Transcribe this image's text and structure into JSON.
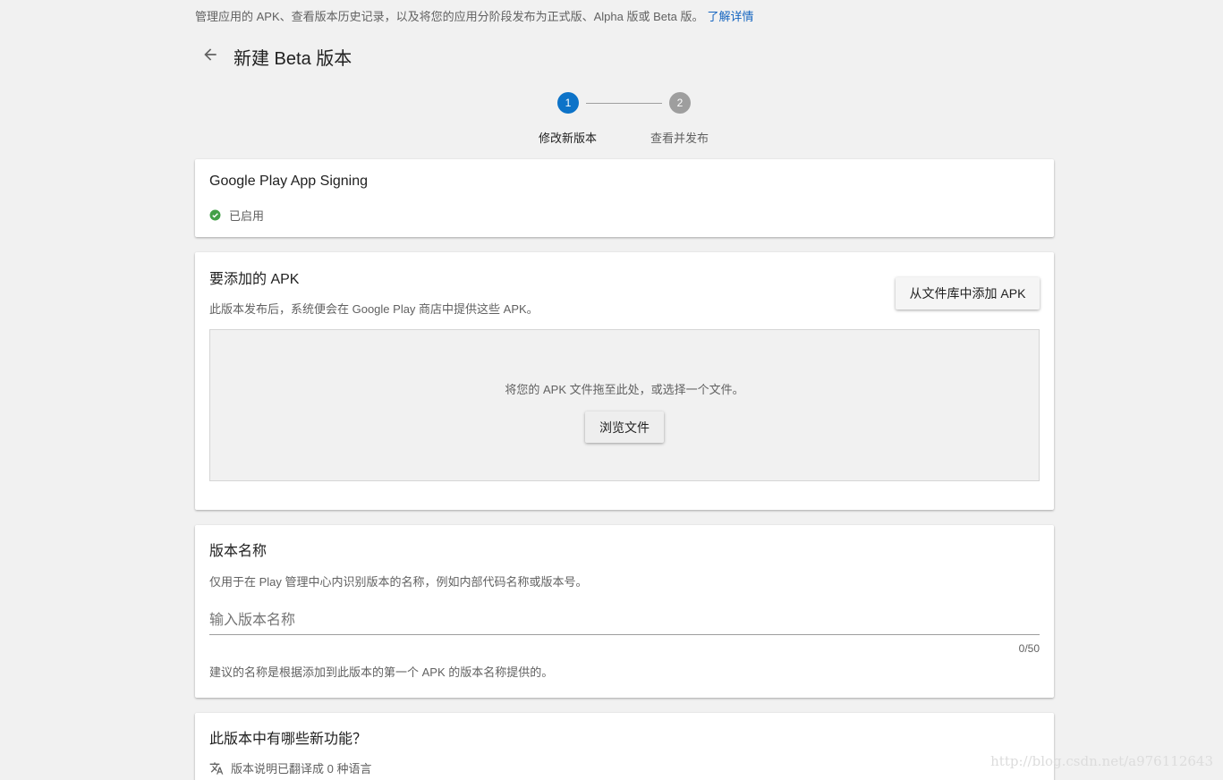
{
  "intro": {
    "text": "管理应用的 APK、查看版本历史记录，以及将您的应用分阶段发布为正式版、Alpha 版或 Beta 版。",
    "link": "了解详情"
  },
  "header": {
    "title": "新建 Beta 版本"
  },
  "stepper": {
    "steps": [
      {
        "number": "1",
        "label": "修改新版本",
        "active": true
      },
      {
        "number": "2",
        "label": "查看并发布",
        "active": false
      }
    ]
  },
  "signing": {
    "title": "Google Play App Signing",
    "status": "已启用"
  },
  "apks": {
    "title": "要添加的 APK",
    "subtitle": "此版本发布后，系统便会在 Google Play 商店中提供这些 APK。",
    "library_button": "从文件库中添加 APK",
    "drop_text": "将您的 APK 文件拖至此处，或选择一个文件。",
    "browse_button": "浏览文件"
  },
  "release_name": {
    "title": "版本名称",
    "subtitle": "仅用于在 Play 管理中心内识别版本的名称，例如内部代码名称或版本号。",
    "placeholder": "输入版本名称",
    "counter": "0/50",
    "hint": "建议的名称是根据添加到此版本的第一个 APK 的版本名称提供的。"
  },
  "notes": {
    "title": "此版本中有哪些新功能？",
    "translations": "版本说明已翻译成 0 种语言"
  },
  "watermark": "http://blog.csdn.net/a976112643",
  "colors": {
    "primary": "#0d73c8",
    "success": "#43a047",
    "link": "#1565c0"
  },
  "icons": {
    "back": "arrow-left",
    "status": "check-circle",
    "translate": "translate"
  }
}
